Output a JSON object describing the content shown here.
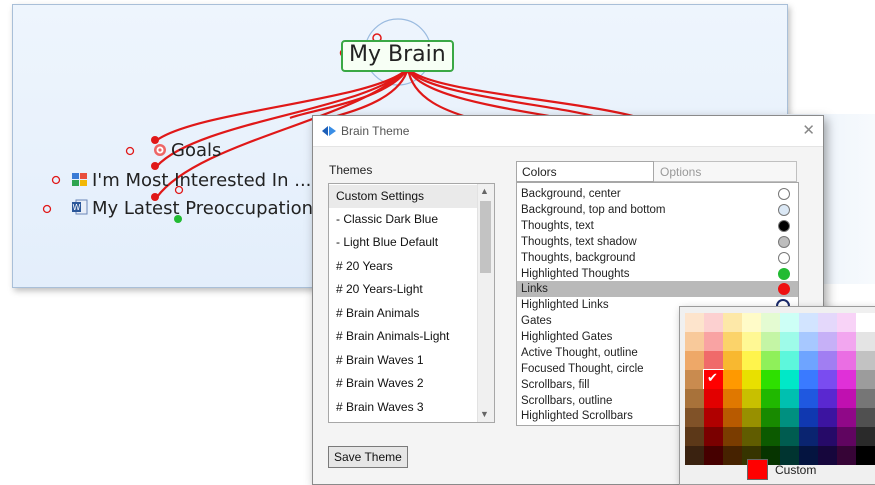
{
  "map": {
    "central": "My Brain",
    "children": [
      "Goals",
      "I'm Most Interested In ...",
      "My Latest Preoccupations"
    ]
  },
  "dialog": {
    "title": "Brain Theme",
    "close_glyph": "✕",
    "themes_label": "Themes",
    "themes": [
      "Custom Settings",
      "- Classic Dark Blue",
      "- Light Blue Default",
      "# 20 Years",
      "# 20 Years-Light",
      "# Brain Animals",
      "# Brain Animals-Light",
      "# Brain Waves 1",
      "# Brain Waves 2",
      "# Brain Waves 3"
    ],
    "selected_theme": "Custom Settings",
    "tabs": [
      "Colors",
      "Options"
    ],
    "colors": [
      {
        "label": "Background, center",
        "swatch": "#ffffff"
      },
      {
        "label": "Background, top and bottom",
        "swatch": "#dbe8f5"
      },
      {
        "label": "Thoughts, text",
        "swatch": "#000000"
      },
      {
        "label": "Thoughts, text shadow",
        "swatch": "#bdbdbd"
      },
      {
        "label": "Thoughts, background",
        "swatch": "#ffffff"
      },
      {
        "label": "Highlighted Thoughts",
        "swatch": "#22bb33"
      },
      {
        "label": "Links",
        "swatch": "#ee1111"
      },
      {
        "label": "Highlighted Links",
        "swatch": "#1a2a6a"
      },
      {
        "label": "Gates",
        "swatch": ""
      },
      {
        "label": "Highlighted Gates",
        "swatch": ""
      },
      {
        "label": "Active Thought, outline",
        "swatch": ""
      },
      {
        "label": "Focused Thought, circle",
        "swatch": ""
      },
      {
        "label": "Scrollbars, fill",
        "swatch": ""
      },
      {
        "label": "Scrollbars, outline",
        "swatch": ""
      },
      {
        "label": "Highlighted Scrollbars",
        "swatch": ""
      }
    ],
    "selected_color": "Links",
    "save_label": "Save Theme"
  },
  "picker": {
    "custom_label": "Custom",
    "custom_color": "#ff0000",
    "checkmark": "✔",
    "grid": [
      [
        "#fde4cc",
        "#fcd0d0",
        "#fde8a8",
        "#fffbc8",
        "#e4fbd2",
        "#cdfff6",
        "#d2e4ff",
        "#e4d8fb",
        "#f8d3f7",
        "#ffffff"
      ],
      [
        "#f8c99a",
        "#f9a3a3",
        "#fbd36a",
        "#fff894",
        "#c4f5a5",
        "#9efbe9",
        "#a7c8ff",
        "#c6b0f7",
        "#f2a6ef",
        "#e4e4e4"
      ],
      [
        "#eea868",
        "#f06a6a",
        "#f8b830",
        "#fff44c",
        "#8ff05a",
        "#5df7dc",
        "#6ea4ff",
        "#a17ef2",
        "#ea6ee3",
        "#c2c2c2"
      ],
      [
        "#c98b4f",
        "#ff0000",
        "#ff9900",
        "#e8e000",
        "#2ee000",
        "#00e8c8",
        "#3a7aff",
        "#7a4cf0",
        "#e030d8",
        "#9c9c9c"
      ],
      [
        "#a8723a",
        "#e20000",
        "#e07800",
        "#c8c000",
        "#20b800",
        "#00c0b0",
        "#1f58e0",
        "#5a28d0",
        "#c010b0",
        "#767676"
      ],
      [
        "#805228",
        "#b00000",
        "#b85a00",
        "#989000",
        "#188a00",
        "#009080",
        "#1038b0",
        "#3c14a0",
        "#900888",
        "#505050"
      ],
      [
        "#5c3818",
        "#7a0000",
        "#7a3c00",
        "#605c00",
        "#0c5a00",
        "#005c50",
        "#0a2470",
        "#260a68",
        "#600560",
        "#2a2a2a"
      ],
      [
        "#3a2210",
        "#460000",
        "#462200",
        "#363400",
        "#063400",
        "#003430",
        "#041440",
        "#16063c",
        "#360436",
        "#000000"
      ]
    ]
  }
}
